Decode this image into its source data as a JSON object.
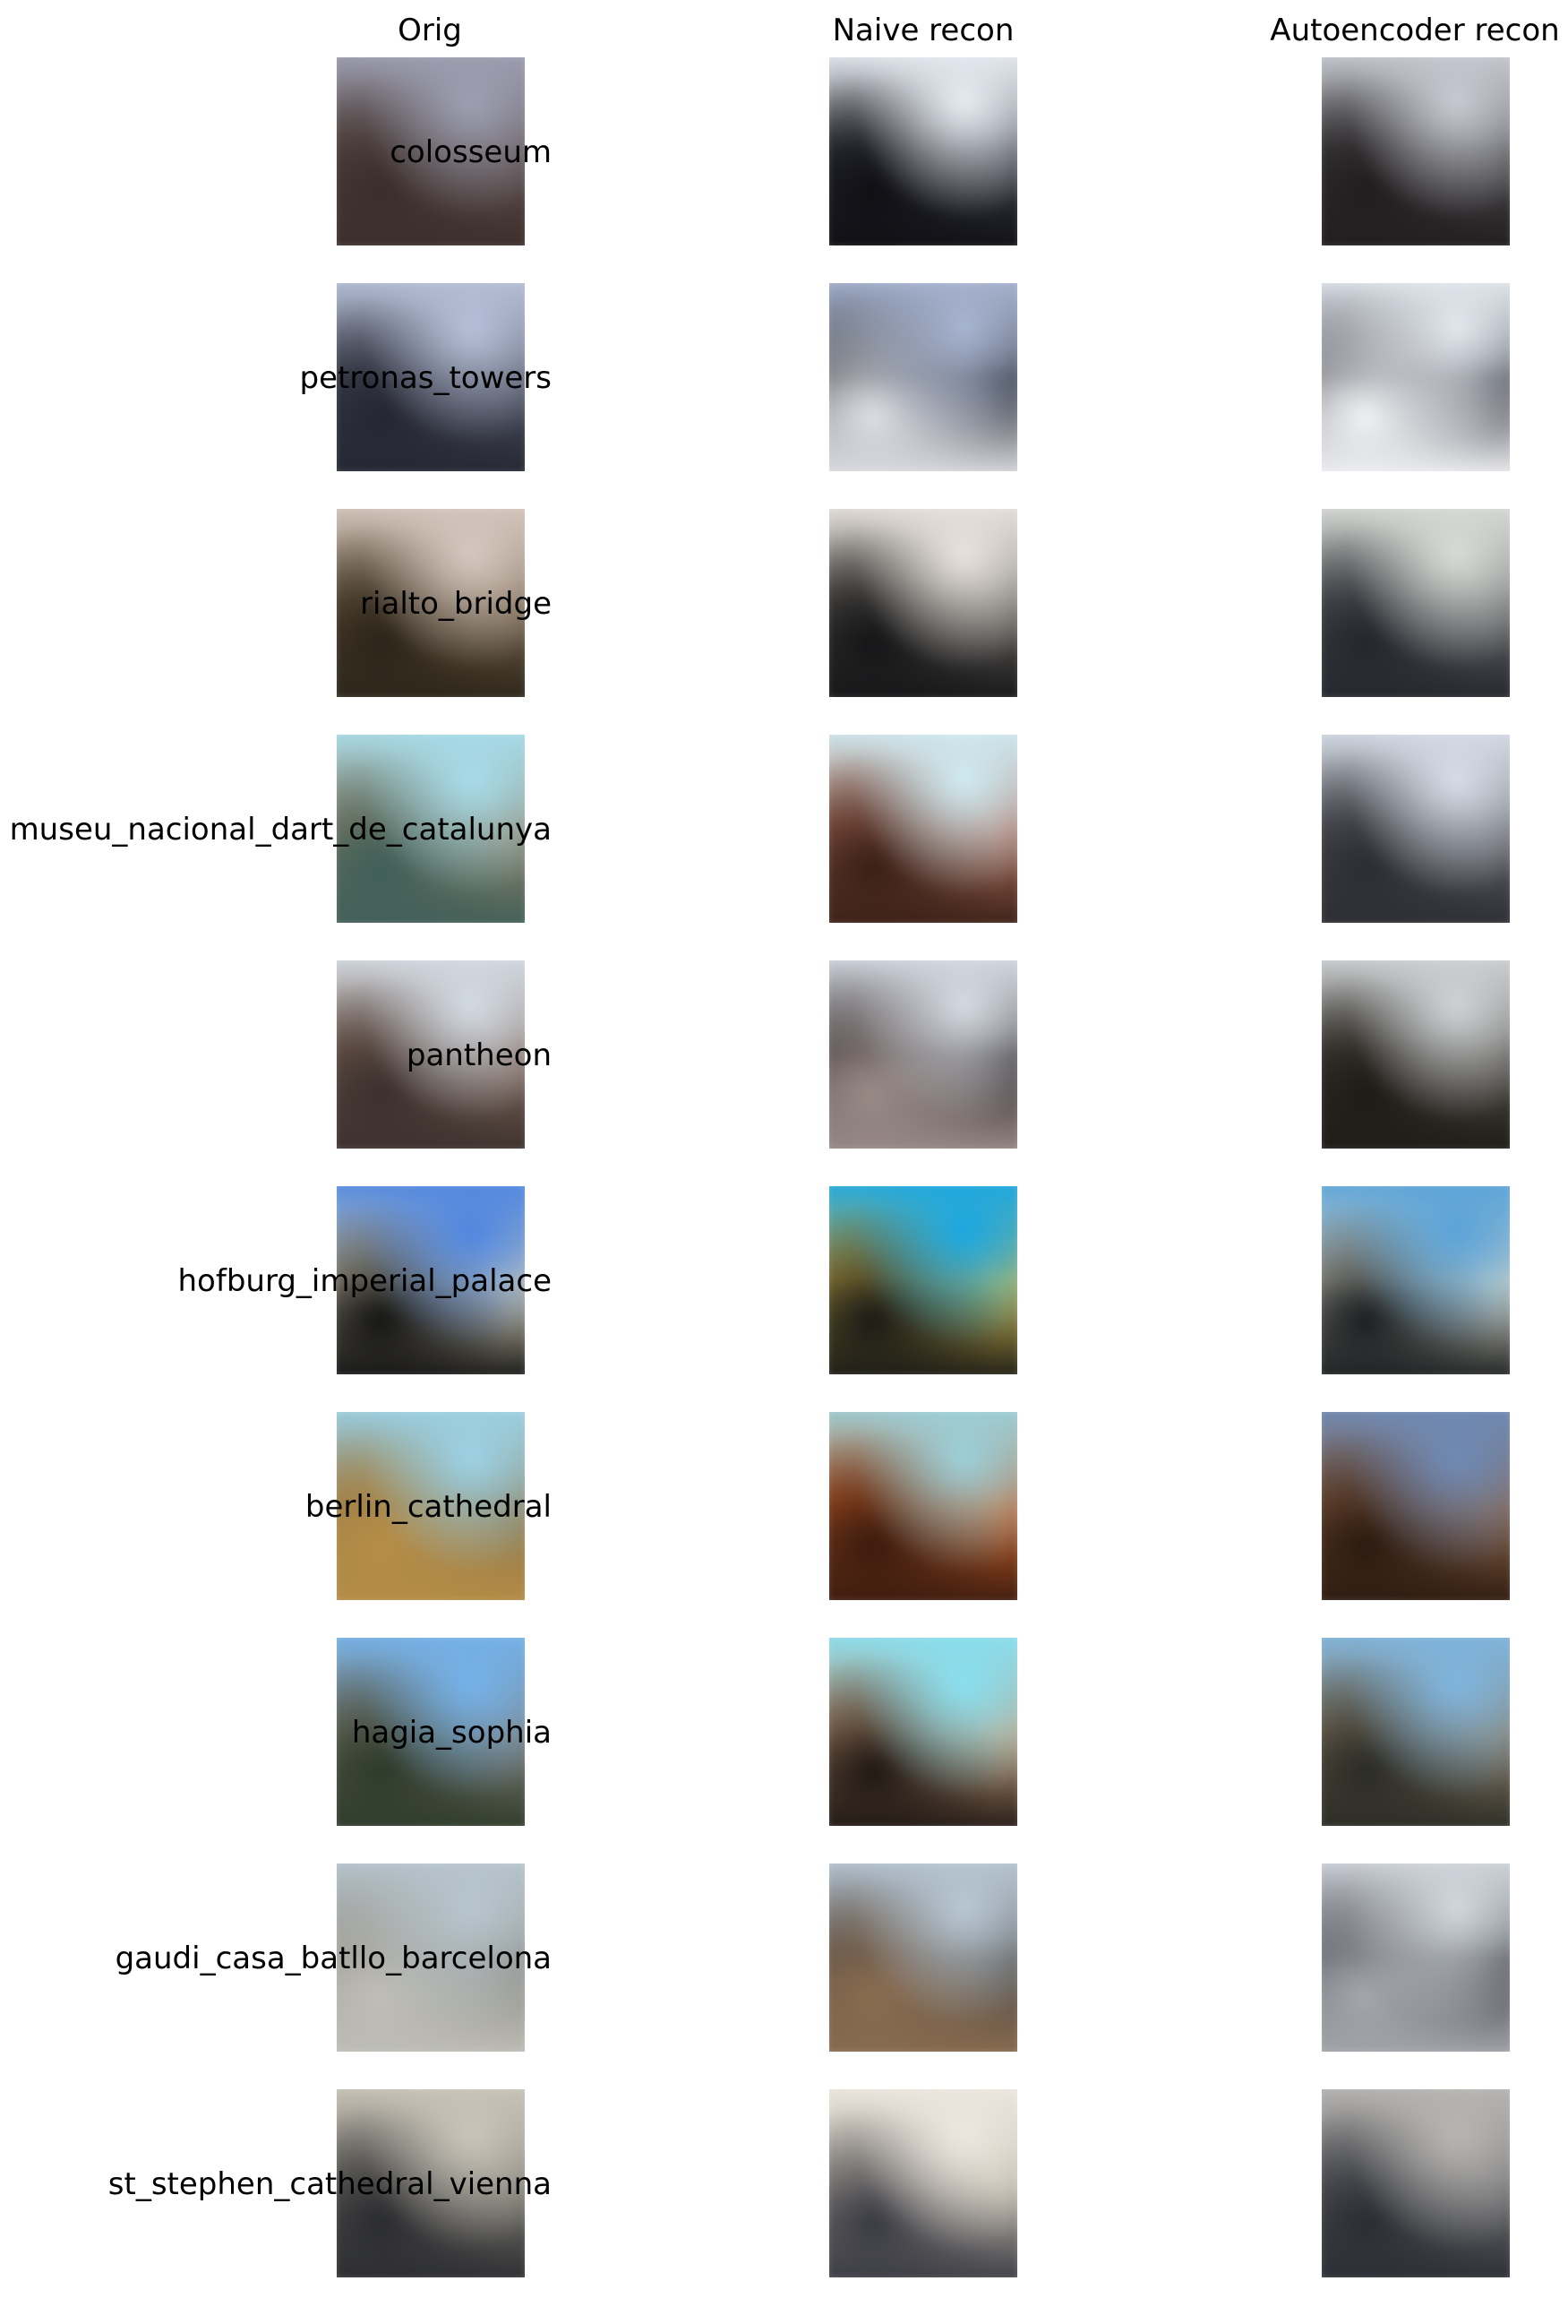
{
  "columns": {
    "orig": "Orig",
    "naive": "Naive recon",
    "autoencoder": "Autoencoder recon"
  },
  "rows": [
    {
      "label": "colosseum",
      "orig": [
        "#9d9fb2",
        "#5a4b49",
        "#3b2e2a"
      ],
      "naive": [
        "#e7ebf2",
        "#3a3d46",
        "#0f0f14"
      ],
      "autoencoder": [
        "#c7cad2",
        "#454446",
        "#211d1f"
      ]
    },
    {
      "label": "petronas_towers",
      "orig": [
        "#b6c0d8",
        "#4a4e5c",
        "#242631"
      ],
      "naive": [
        "#a9b6d2",
        "#272b34",
        "#dedfe4"
      ],
      "autoencoder": [
        "#e4e8ef",
        "#3a3d46",
        "#f1f2f5"
      ]
    },
    {
      "label": "rialto_bridge",
      "orig": [
        "#d6c8bf",
        "#6e5c47",
        "#2b2418"
      ],
      "naive": [
        "#e8e3dd",
        "#5e5b56",
        "#151517"
      ],
      "autoencoder": [
        "#d8dbd6",
        "#5c6062",
        "#23272d"
      ]
    },
    {
      "label": "museu_nacional_dart_de_catalunya",
      "orig": [
        "#a7dcea",
        "#8e8268",
        "#3f5e58"
      ],
      "naive": [
        "#cfeaf2",
        "#a76a57",
        "#3a1f16"
      ],
      "autoencoder": [
        "#d6dde6",
        "#5b5c63",
        "#2b2d33"
      ]
    },
    {
      "label": "pantheon",
      "orig": [
        "#d3dbe4",
        "#7b6255",
        "#3b302d"
      ],
      "naive": [
        "#d6dbe3",
        "#2f2b2e",
        "#9a8b87"
      ],
      "autoencoder": [
        "#cfd3d6",
        "#4a463f",
        "#1e1b17"
      ]
    },
    {
      "label": "hofburg_imperial_palace",
      "orig": [
        "#4f86e0",
        "#d9d2b5",
        "#141414"
      ],
      "naive": [
        "#1aa7e2",
        "#d4b649",
        "#1a1a16"
      ],
      "autoencoder": [
        "#5aa3d8",
        "#d8d6c6",
        "#1b1e20"
      ]
    },
    {
      "label": "berlin_cathedral",
      "orig": [
        "#9cd2e6",
        "#8c7346",
        "#b68d47"
      ],
      "naive": [
        "#9bd0da",
        "#c45c23",
        "#3b1b0f"
      ],
      "autoencoder": [
        "#6e8ab6",
        "#8a6042",
        "#2c1a10"
      ]
    },
    {
      "label": "hagia_sophia",
      "orig": [
        "#74b2ea",
        "#7f7a6f",
        "#2d3a2a"
      ],
      "naive": [
        "#88dff0",
        "#c79b77",
        "#201814"
      ],
      "autoencoder": [
        "#7fb5de",
        "#8b7b63",
        "#2a2b25"
      ]
    },
    {
      "label": "gaudi_casa_batllo_barcelona",
      "orig": [
        "#b8c6cf",
        "#8a8a82",
        "#bfbfb8"
      ],
      "naive": [
        "#b9c8d5",
        "#4d4a47",
        "#8a6b4e"
      ],
      "autoencoder": [
        "#d3d7de",
        "#3e4148",
        "#a4a8ad"
      ]
    },
    {
      "label": "st_stephen_cathedral_vienna",
      "orig": [
        "#c9c5ba",
        "#76736a",
        "#2b2c30"
      ],
      "naive": [
        "#ece7df",
        "#b8b0a3",
        "#3a3b43"
      ],
      "autoencoder": [
        "#b8b6b3",
        "#6a6a6d",
        "#2a2d33"
      ]
    }
  ]
}
